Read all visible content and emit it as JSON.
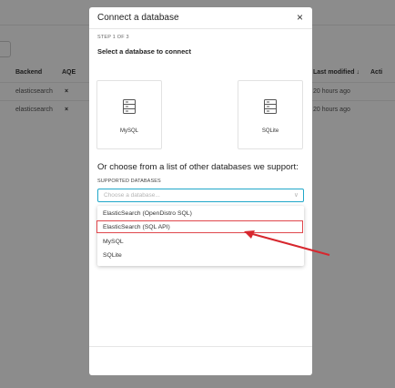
{
  "background_table": {
    "headers": {
      "backend": "Backend",
      "aqe": "AQE",
      "last_modified": "Last modified",
      "actions": "Acti"
    },
    "rows": [
      {
        "backend": "elasticsearch",
        "aqe": "×",
        "last_modified": "20 hours ago"
      },
      {
        "backend": "elasticsearch",
        "aqe": "×",
        "last_modified": "20 hours ago"
      }
    ],
    "sort_indicator": "↓"
  },
  "modal": {
    "title": "Connect a database",
    "close_symbol": "×",
    "step": "STEP 1 OF 3",
    "subtitle": "Select a database to connect",
    "cards": [
      {
        "label": "MySQL",
        "icon": "database-server-icon"
      },
      {
        "label": "SQLite",
        "icon": "database-server-icon"
      }
    ],
    "other_heading": "Or choose from a list of other databases we support:",
    "supported_label": "SUPPORTED DATABASES",
    "select": {
      "placeholder": "Choose a database...",
      "chevron": "∨"
    },
    "options": [
      "ElasticSearch (OpenDistro SQL)",
      "ElasticSearch (SQL API)",
      "MySQL",
      "SQLite"
    ],
    "highlighted_option_index": 1
  },
  "colors": {
    "overlay": "rgba(0,0,0,0.45)",
    "select_border": "#20a7c9",
    "highlight": "#e0474c",
    "arrow": "#d7272e"
  }
}
